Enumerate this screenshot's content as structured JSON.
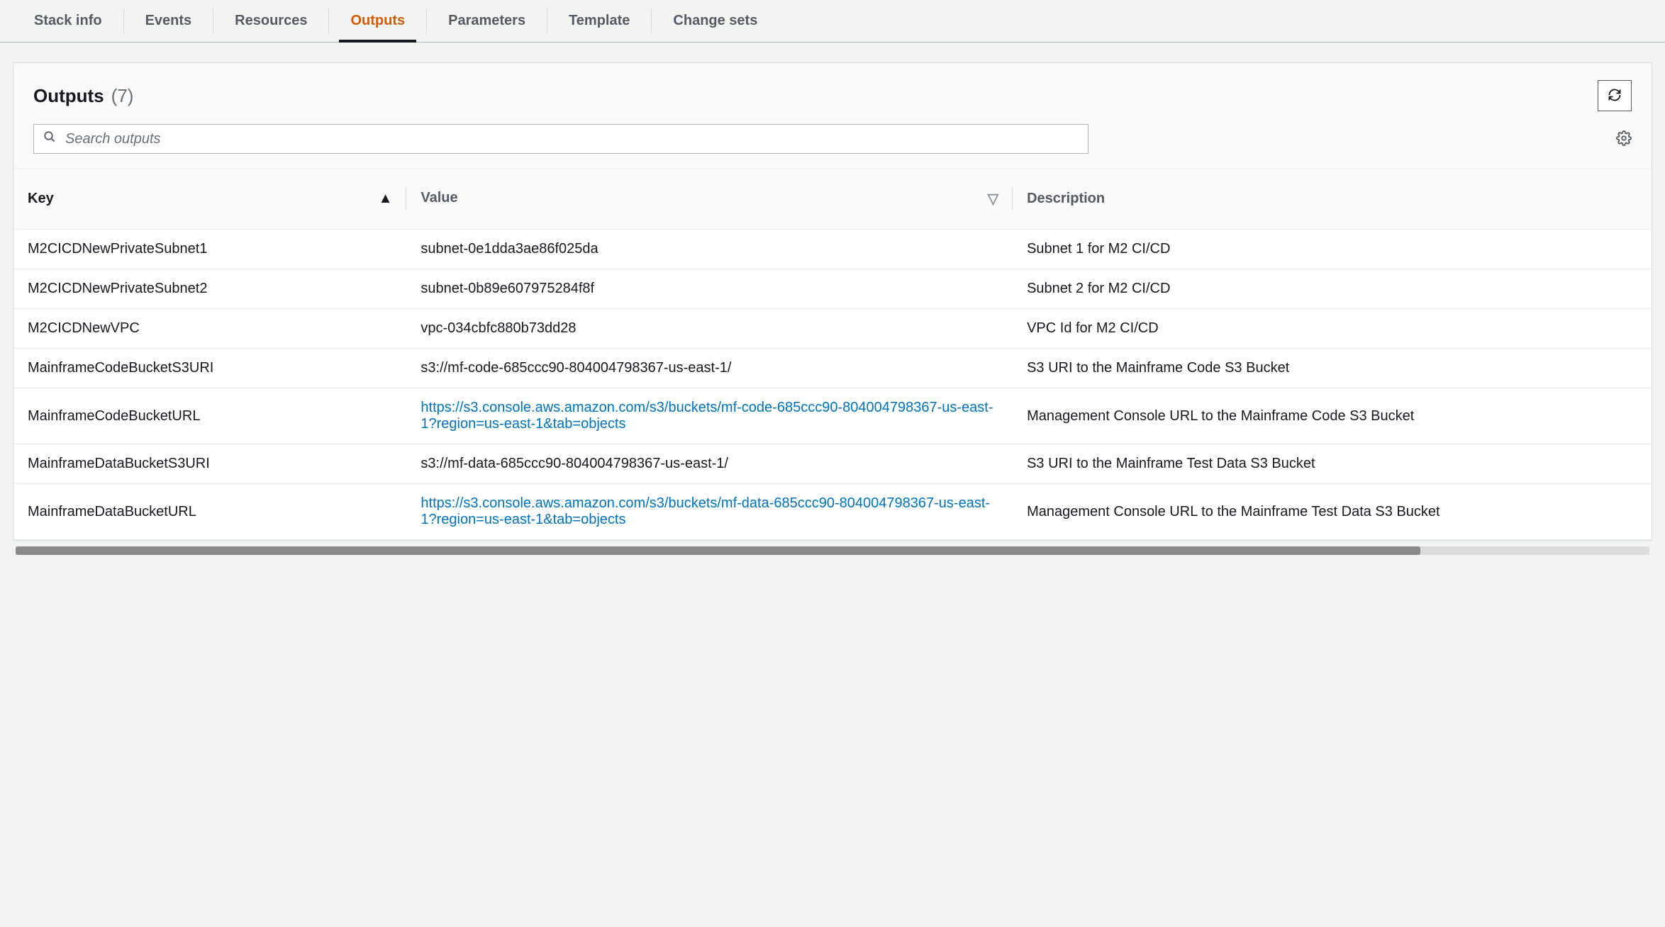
{
  "tabs": [
    {
      "label": "Stack info",
      "active": false
    },
    {
      "label": "Events",
      "active": false
    },
    {
      "label": "Resources",
      "active": false
    },
    {
      "label": "Outputs",
      "active": true
    },
    {
      "label": "Parameters",
      "active": false
    },
    {
      "label": "Template",
      "active": false
    },
    {
      "label": "Change sets",
      "active": false
    }
  ],
  "panel": {
    "title": "Outputs",
    "count_label": "(7)"
  },
  "search": {
    "placeholder": "Search outputs"
  },
  "columns": {
    "key": "Key",
    "value": "Value",
    "description": "Description"
  },
  "rows": [
    {
      "key": "M2CICDNewPrivateSubnet1",
      "value": "subnet-0e1dda3ae86f025da",
      "is_link": false,
      "description": "Subnet 1 for M2 CI/CD"
    },
    {
      "key": "M2CICDNewPrivateSubnet2",
      "value": "subnet-0b89e607975284f8f",
      "is_link": false,
      "description": "Subnet 2 for M2 CI/CD"
    },
    {
      "key": "M2CICDNewVPC",
      "value": "vpc-034cbfc880b73dd28",
      "is_link": false,
      "description": "VPC Id for M2 CI/CD"
    },
    {
      "key": "MainframeCodeBucketS3URI",
      "value": "s3://mf-code-685ccc90-804004798367-us-east-1/",
      "is_link": false,
      "description": "S3 URI to the Mainframe Code S3 Bucket"
    },
    {
      "key": "MainframeCodeBucketURL",
      "value": "https://s3.console.aws.amazon.com/s3/buckets/mf-code-685ccc90-804004798367-us-east-1?region=us-east-1&tab=objects",
      "is_link": true,
      "description": "Management Console URL to the Mainframe Code S3 Bucket"
    },
    {
      "key": "MainframeDataBucketS3URI",
      "value": "s3://mf-data-685ccc90-804004798367-us-east-1/",
      "is_link": false,
      "description": "S3 URI to the Mainframe Test Data S3 Bucket"
    },
    {
      "key": "MainframeDataBucketURL",
      "value": "https://s3.console.aws.amazon.com/s3/buckets/mf-data-685ccc90-804004798367-us-east-1?region=us-east-1&tab=objects",
      "is_link": true,
      "description": "Management Console URL to the Mainframe Test Data S3 Bucket"
    }
  ]
}
